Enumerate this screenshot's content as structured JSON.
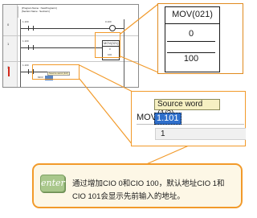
{
  "editor": {
    "header_line1": "[Program Name : NewProgram1]",
    "header_line2": "[Section Name : Section1]",
    "rows": [
      "0",
      "1",
      "2"
    ],
    "rung_labels": {
      "contact1": "1.100",
      "coil1": "0.100",
      "contact2": "1.100",
      "contact3": "1.100"
    },
    "mini_block_title": "MOV(021)",
    "mini_block_v1": "0",
    "mini_block_v2": "100",
    "popup_title": "Source word (1/2)",
    "popup_prefix": "MOV"
  },
  "zoom_block": {
    "title": "MOV(021)",
    "source": "0",
    "dest": "100"
  },
  "zoom_entry": {
    "tooltip": "Source word (1/2)",
    "instruction": "MOV",
    "selected_text": "1.101",
    "row_value": "1"
  },
  "note": {
    "key_label": "enter",
    "text": "通过增加CIO 0和CIO 100，默认地址CIO 1和CIO 101会显示先前输入的地址。"
  },
  "colors": {
    "accent_orange": "#f29a2a",
    "selection_blue": "#2f6fcb",
    "note_bg": "#fdf7e6",
    "key_green": "#a9c78b"
  }
}
